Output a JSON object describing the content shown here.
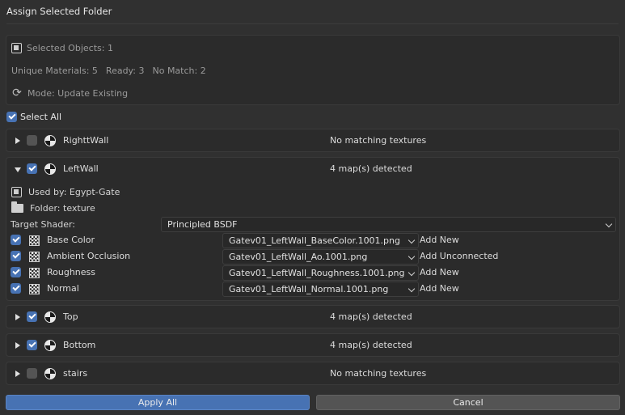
{
  "dialog": {
    "title": "Assign Selected Folder"
  },
  "info": {
    "selected_objects": "Selected Objects: 1",
    "unique_materials": "Unique Materials: 5",
    "ready": "Ready: 3",
    "no_match": "No Match: 2",
    "mode": "Mode: Update Existing"
  },
  "select_all": {
    "label": "Select All",
    "checked": true
  },
  "materials": [
    {
      "name": "RighttWall",
      "checked": false,
      "expanded": false,
      "status": "No matching textures"
    },
    {
      "name": "LeftWall",
      "checked": true,
      "expanded": true,
      "status": "4 map(s) detected",
      "used_by": "Used by: Egypt-Gate",
      "folder": "Folder: texture",
      "target_shader_label": "Target Shader:",
      "target_shader": "Principled BSDF",
      "maps": [
        {
          "label": "Base Color",
          "file": "Gatev01_LeftWall_BaseColor.1001.png",
          "action": "Add New"
        },
        {
          "label": "Ambient Occlusion",
          "file": "Gatev01_LeftWall_Ao.1001.png",
          "action": "Add Unconnected"
        },
        {
          "label": "Roughness",
          "file": "Gatev01_LeftWall_Roughness.1001.png",
          "action": "Add New"
        },
        {
          "label": "Normal",
          "file": "Gatev01_LeftWall_Normal.1001.png",
          "action": "Add New"
        }
      ]
    },
    {
      "name": "Top",
      "checked": true,
      "expanded": false,
      "status": "4 map(s) detected"
    },
    {
      "name": "Bottom",
      "checked": true,
      "expanded": false,
      "status": "4 map(s) detected"
    },
    {
      "name": "stairs",
      "checked": false,
      "expanded": false,
      "status": "No matching textures"
    }
  ],
  "buttons": {
    "apply": "Apply All",
    "cancel": "Cancel"
  }
}
